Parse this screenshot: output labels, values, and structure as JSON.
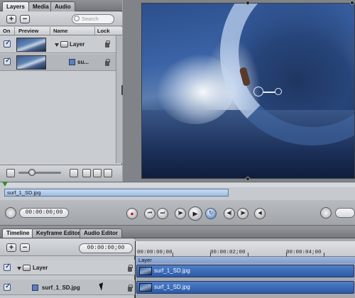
{
  "inspector": {
    "tabs": [
      "Layers",
      "Media",
      "Audio"
    ],
    "active_tab": "Layers",
    "search_placeholder": "Search",
    "add_label": "+",
    "remove_label": "−",
    "columns": {
      "on": "On",
      "preview": "Preview",
      "name": "Name",
      "lock": "Lock"
    },
    "rows": [
      {
        "name": "Layer",
        "enabled": true,
        "type": "group"
      },
      {
        "name": "su...",
        "enabled": true,
        "type": "clip"
      }
    ]
  },
  "canvas": {
    "icons": [
      "transform-handle-icon"
    ]
  },
  "mini_timeline": {
    "clip_name": "surf_1_SD.jpg"
  },
  "transport": {
    "current_timecode": "00:00:00;00",
    "buttons": [
      "record",
      "go-to-start",
      "go-to-end",
      "play-from-start",
      "play",
      "loop",
      "previous-frame",
      "next-frame",
      "audio"
    ]
  },
  "timeline": {
    "tabs": [
      "Timeline",
      "Keyframe Editor",
      "Audio Editor"
    ],
    "active_tab": "Timeline",
    "add_label": "+",
    "remove_label": "−",
    "current_timecode": "00:00:00;00",
    "ruler_labels": [
      "00:00:00;00",
      "00:00:02;00",
      "00:00:04;00"
    ],
    "group_bar_label": "Layer",
    "tracks": [
      {
        "name": "Layer",
        "enabled": true,
        "clip": "surf_1_SD.jpg"
      },
      {
        "name": "surf_1_SD.jpg",
        "enabled": true,
        "clip": "surf_1_SD.jpg"
      }
    ]
  },
  "colors": {
    "accent_blue": "#2c5aa6",
    "record_red": "#c81c1c",
    "playhead_green": "#2f8f2f"
  }
}
